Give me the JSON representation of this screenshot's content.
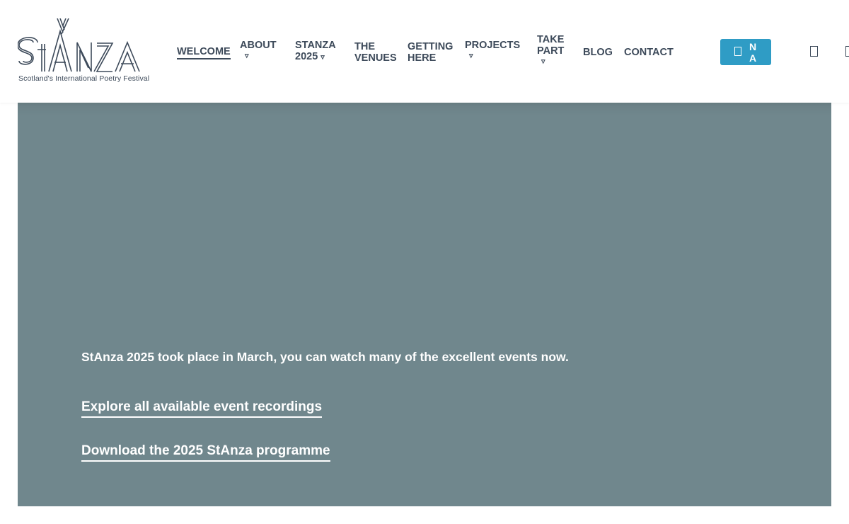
{
  "logo": {
    "name": "StAnza",
    "tagline": "Scotland's International Poetry Festival"
  },
  "nav": {
    "items": [
      {
        "label": "WELCOME",
        "has_submenu": false,
        "active": true
      },
      {
        "label": "ABOUT",
        "has_submenu": true
      },
      {
        "label": "STANZA 2025",
        "has_submenu": true
      },
      {
        "label": "THE VENUES",
        "has_submenu": false
      },
      {
        "label": "GETTING HERE",
        "has_submenu": false
      },
      {
        "label": "PROJECTS",
        "has_submenu": true
      },
      {
        "label": "TAKE PART",
        "has_submenu": true
      },
      {
        "label": "BLOG",
        "has_submenu": false
      },
      {
        "label": "CONTACT",
        "has_submenu": false
      }
    ],
    "chevron_icon": "chevron-down-icon",
    "na_button": {
      "line1": "N",
      "line2": "A",
      "icon": "box-icon"
    },
    "search_icon": "search-icon",
    "menu_icon": "menu-icon"
  },
  "hero": {
    "text": "StAnza 2025 took place in March, you can watch many of the excellent events now.",
    "links": [
      "Explore all available event recordings",
      "Download the 2025 StAnza programme"
    ]
  },
  "colors": {
    "text": "#3d4a5a",
    "accent": "#2f9cc5",
    "hero_bg": "#70878d",
    "white": "#ffffff"
  }
}
